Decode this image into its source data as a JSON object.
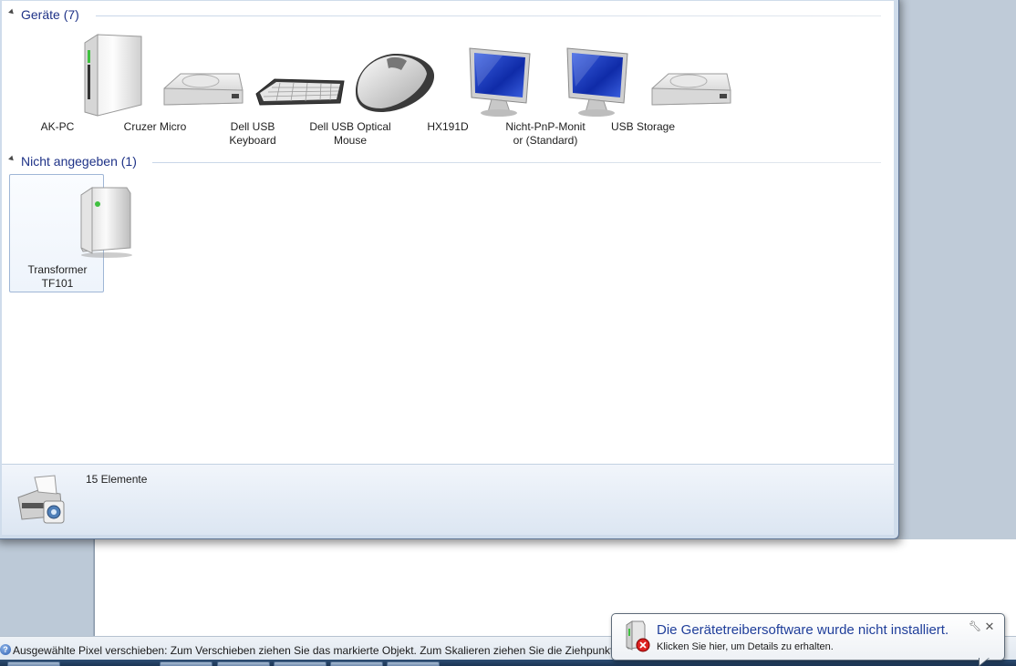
{
  "explorer": {
    "groups": [
      {
        "title": "Geräte (7)",
        "devices": [
          {
            "label": "AK-PC",
            "icon": "computer-tower-icon"
          },
          {
            "label": "Cruzer Micro",
            "icon": "drive-icon"
          },
          {
            "label": "Dell USB\nKeyboard",
            "icon": "keyboard-icon"
          },
          {
            "label": "Dell USB Optical\nMouse",
            "icon": "mouse-icon"
          },
          {
            "label": "HX191D",
            "icon": "monitor-icon"
          },
          {
            "label": "Nicht-PnP-Monit\nor (Standard)",
            "icon": "monitor-icon"
          },
          {
            "label": "USB Storage",
            "icon": "drive-icon"
          }
        ]
      },
      {
        "title": "Nicht angegeben (1)",
        "devices": [
          {
            "label": "Transformer\nTF101",
            "icon": "generic-device-icon",
            "selected": true
          }
        ]
      }
    ],
    "details": {
      "count": "15 Elemente",
      "icon": "printer-camera-icon"
    }
  },
  "paint": {
    "status_text": "Ausgewählte Pixel verschieben: Zum Verschieben ziehen Sie das markierte Objekt. Zum Skalieren ziehen Sie die Ziehpunkte. Zum"
  },
  "notification": {
    "title": "Die Gerätetreibersoftware wurde nicht installiert.",
    "text": "Klicken Sie hier, um Details zu erhalten.",
    "icon": "device-error-icon",
    "options_icon": "wrench-icon",
    "close_icon": "close-icon"
  }
}
